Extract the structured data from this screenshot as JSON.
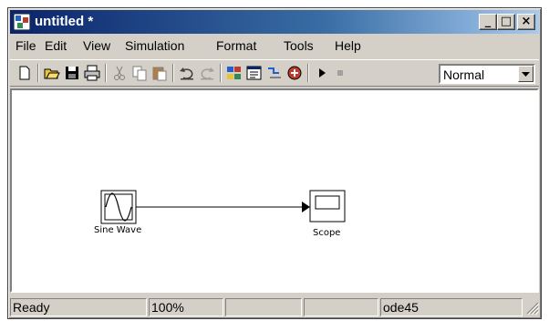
{
  "window": {
    "title": "untitled *"
  },
  "title_buttons": {
    "minimize": "_",
    "maximize": "□",
    "close": "×"
  },
  "menu": [
    "File",
    "Edit",
    "View",
    "Simulation",
    "Format",
    "Tools",
    "Help"
  ],
  "toolbar": {
    "icons": [
      "new-model-icon",
      "open-icon",
      "save-icon",
      "print-icon",
      "cut-icon",
      "copy-icon",
      "paste-icon",
      "undo-icon",
      "redo-icon",
      "library-browser-icon",
      "model-browser-icon",
      "toggle-icon",
      "debug-icon",
      "start-simulation-icon",
      "stop-simulation-icon"
    ],
    "mode": "Normal"
  },
  "blocks": [
    {
      "label": "Sine Wave",
      "icon": "sine-wave-icon"
    },
    {
      "label": "Scope",
      "icon": "scope-icon"
    }
  ],
  "status": {
    "state": "Ready",
    "zoom": "100%",
    "cell3": "",
    "cell4": "",
    "solver": "ode45"
  },
  "colors": {
    "title_dark": "#0a246a",
    "title_light": "#a6caf0",
    "face": "#d4d0c8"
  }
}
